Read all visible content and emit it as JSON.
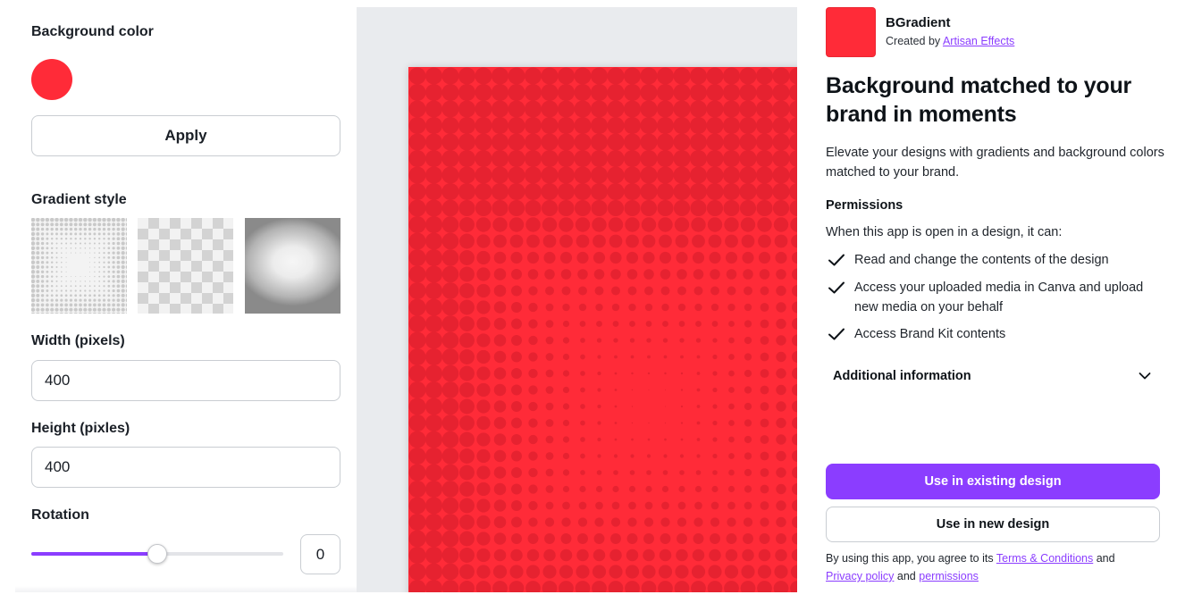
{
  "left_panel": {
    "background_color_label": "Background color",
    "background_color": "#ff2b38",
    "apply_label": "Apply",
    "gradient_style_label": "Gradient style",
    "gradient_styles": [
      "halftone-radial",
      "checkerboard",
      "radial-vignette"
    ],
    "width_label": "Width (pixels)",
    "width_value": "400",
    "height_label": "Height (pixles)",
    "height_value": "400",
    "rotation_label": "Rotation",
    "rotation_value": "0",
    "rotation_slider_fraction": 0.5,
    "accent_color": "#8b3dff"
  },
  "canvas": {
    "background": "#e9ebee",
    "page_color": "#ff2b38",
    "dot_color": "#e62230"
  },
  "app": {
    "name": "BGradient",
    "created_by_prefix": "Created by",
    "creator": "Artisan Effects",
    "headline": "Background matched to your brand in moments",
    "description": "Elevate your designs with gradients and background colors matched to your brand.",
    "permissions_title": "Permissions",
    "permissions_intro": "When this app is open in a design, it can:",
    "permissions": [
      "Read and change the contents of the design",
      "Access your uploaded media in Canva and upload new media on your behalf",
      "Access Brand Kit contents"
    ],
    "additional_info_label": "Additional information",
    "use_existing_label": "Use in existing design",
    "use_new_label": "Use in new design",
    "terms_prefix": "By using this app, you agree to its",
    "terms_link": "Terms & Conditions",
    "terms_and_1": "and",
    "privacy_link": "Privacy policy",
    "terms_and_2": "and",
    "permissions_link": "permissions",
    "icons": [
      "check-icon",
      "chevron-down-icon"
    ]
  }
}
